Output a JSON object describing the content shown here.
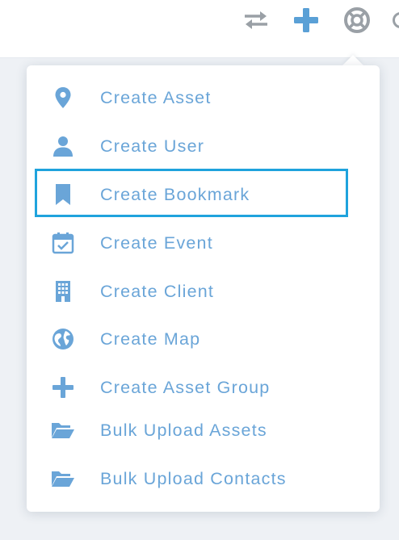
{
  "topbar": {
    "icons": [
      {
        "name": "swap-icon",
        "color": "#9aa0a6"
      },
      {
        "name": "plus-icon",
        "color": "#5aa0d6"
      },
      {
        "name": "lifebuoy-icon",
        "color": "#9aa0a6"
      }
    ]
  },
  "menu": {
    "accent_color": "#6aa5d8",
    "highlight_color": "#1fa3dd",
    "items": [
      {
        "label": "Create Asset",
        "icon": "map-pin-icon"
      },
      {
        "label": "Create User",
        "icon": "user-icon"
      },
      {
        "label": "Create Bookmark",
        "icon": "bookmark-icon",
        "highlighted": true
      },
      {
        "label": "Create Event",
        "icon": "calendar-check-icon"
      },
      {
        "label": "Create Client",
        "icon": "building-icon"
      },
      {
        "label": "Create Map",
        "icon": "globe-icon"
      },
      {
        "label": "Create Asset Group",
        "icon": "plus-icon"
      },
      {
        "label": "Bulk Upload Assets",
        "icon": "folder-open-icon"
      },
      {
        "label": "Bulk Upload Contacts",
        "icon": "folder-open-icon"
      }
    ]
  }
}
